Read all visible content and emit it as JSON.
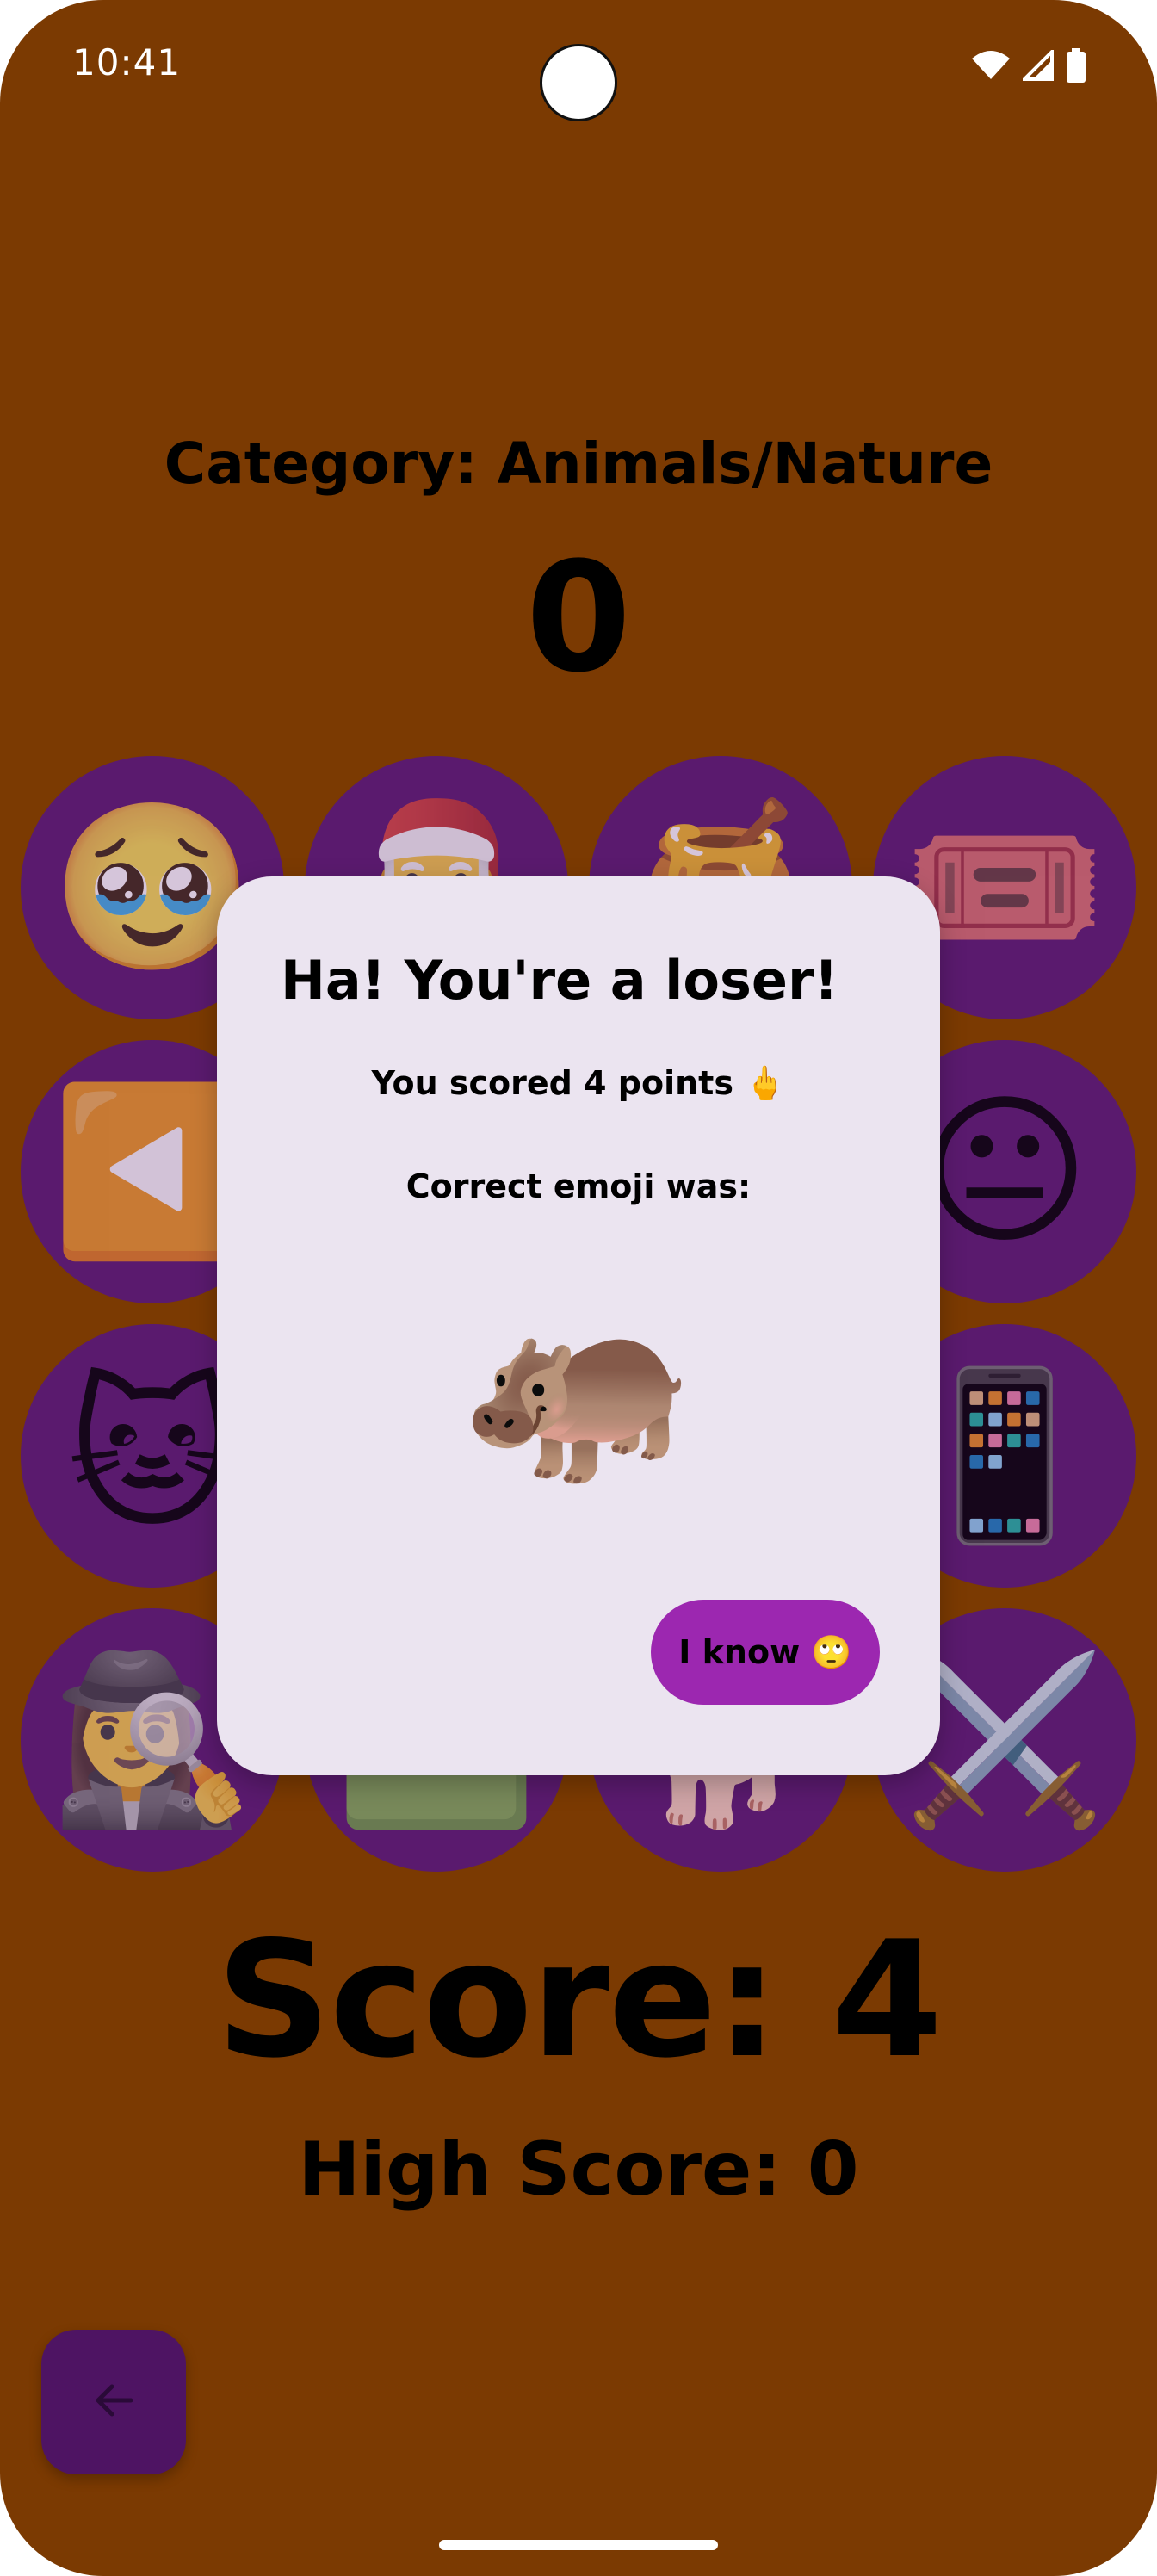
{
  "status_bar": {
    "time": "10:41",
    "icons": [
      "wifi-icon",
      "signal-icon",
      "battery-icon"
    ]
  },
  "game": {
    "category": "Category: Animals/Nature",
    "timer": "0",
    "score": "Score: 4",
    "high_score": "High Score: 0"
  },
  "grid": {
    "cells": [
      {
        "emoji": "🥹",
        "name": "pleading-face"
      },
      {
        "emoji": "🎅",
        "name": "santa"
      },
      {
        "emoji": "🍯",
        "name": "honey-pot"
      },
      {
        "emoji": "🎟️",
        "name": "ticket"
      },
      {
        "emoji": "◀️",
        "name": "reverse-button"
      },
      {
        "emoji": "",
        "name": "hidden"
      },
      {
        "emoji": "",
        "name": "hidden"
      },
      {
        "emoji": "😐",
        "name": "neutral-face"
      },
      {
        "emoji": "🐱",
        "name": "cat-face"
      },
      {
        "emoji": "",
        "name": "hidden"
      },
      {
        "emoji": "",
        "name": "hidden"
      },
      {
        "emoji": "📱",
        "name": "mobile-phone"
      },
      {
        "emoji": "🕵️‍♀️",
        "name": "detective"
      },
      {
        "emoji": "🟩",
        "name": "green-flag"
      },
      {
        "emoji": "🐕",
        "name": "dog"
      },
      {
        "emoji": "⚔️",
        "name": "crossed-swords"
      }
    ]
  },
  "dialog": {
    "title": "Ha! You're a loser!",
    "scored_text": "You scored 4 points 🖕",
    "correct_label": "Correct emoji was:",
    "correct_emoji": "🦛",
    "button_label": "I know 🙄"
  },
  "navigation": {
    "back_icon": "arrow-back-icon"
  },
  "colors": {
    "background": "#7b3a02",
    "cell": "#5a1a6e",
    "dialog": "#ebe4f0",
    "button": "#9c27b0",
    "fab": "#4e1463"
  }
}
